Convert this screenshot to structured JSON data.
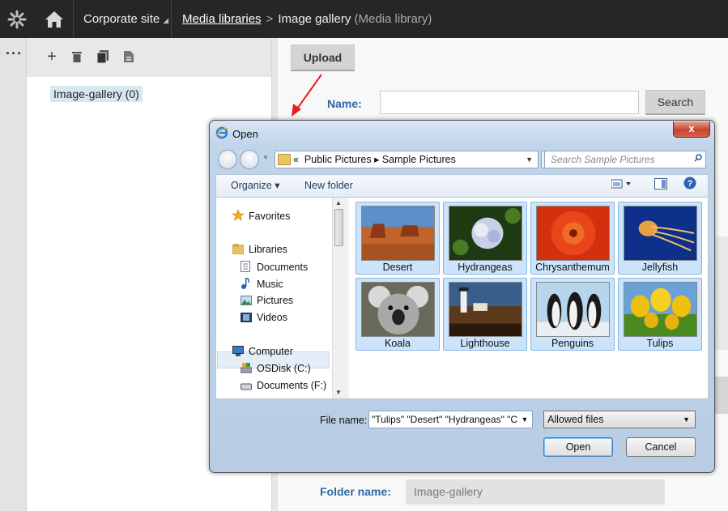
{
  "topbar": {
    "site_label": "Corporate site",
    "breadcrumb_root": "Media libraries",
    "breadcrumb_current": "Image gallery",
    "breadcrumb_type": "(Media library)"
  },
  "tree": {
    "root_node": "Image-gallery (0)"
  },
  "main": {
    "upload_label": "Upload",
    "name_label": "Name:",
    "search_label": "Search",
    "folder_name_label": "Folder name:",
    "folder_name_value": "Image-gallery"
  },
  "dialog": {
    "title": "Open",
    "close_label": "x",
    "address": {
      "prefix": "«",
      "crumb1": "Public Pictures",
      "arrow": "▸",
      "crumb2": "Sample Pictures"
    },
    "search_placeholder": "Search Sample Pictures",
    "organize_label": "Organize ▾",
    "new_folder_label": "New folder",
    "nav": {
      "favorites": "Favorites",
      "libraries": "Libraries",
      "documents": "Documents",
      "music": "Music",
      "pictures": "Pictures",
      "videos": "Videos",
      "computer": "Computer",
      "osdisk": "OSDisk (C:)",
      "documents_f": "Documents (F:)"
    },
    "files": [
      "Desert",
      "Hydrangeas",
      "Chrysanthemum",
      "Jellyfish",
      "Koala",
      "Lighthouse",
      "Penguins",
      "Tulips"
    ],
    "file_name_label": "File name:",
    "file_name_value": "\"Tulips\" \"Desert\" \"Hydrangeas\" \"C",
    "filter_value": "Allowed files",
    "open_label": "Open",
    "cancel_label": "Cancel"
  },
  "colors": {
    "accent": "#2b6aa6",
    "topbar": "#262626",
    "selection": "#cce4fb",
    "arrow": "#e02020"
  }
}
